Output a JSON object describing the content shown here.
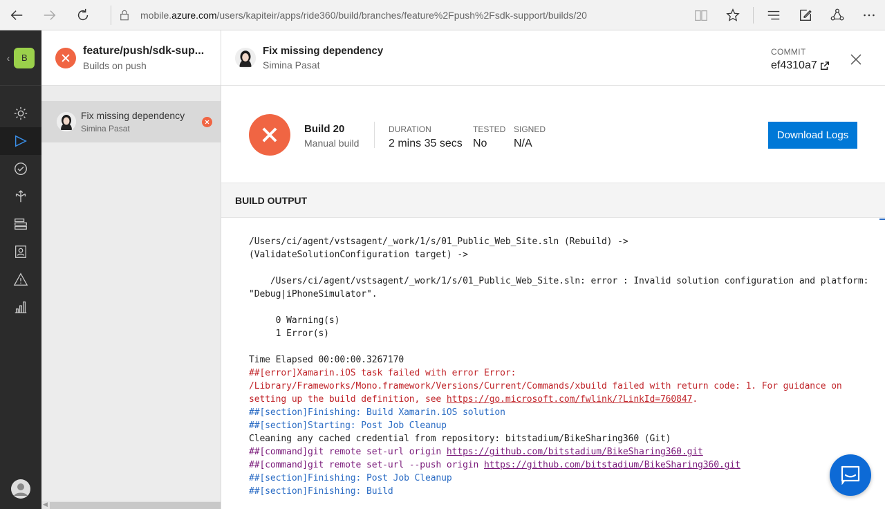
{
  "browser": {
    "url_prefix": "mobile.",
    "url_domain": "azure.com",
    "url_path": "/users/kapiteir/apps/ride360/build/branches/feature%2Fpush%2Fsdk-support/builds/20"
  },
  "rail": {
    "app_badge": "B",
    "items": [
      "overview",
      "build",
      "test",
      "distribute",
      "crashes",
      "analytics-users",
      "errors",
      "analytics"
    ]
  },
  "branch": {
    "title": "feature/push/sdk-sup...",
    "subtitle": "Builds on push"
  },
  "build_list": [
    {
      "title": "Fix missing dependency",
      "author": "Simina Pasat",
      "status": "failed"
    }
  ],
  "commit": {
    "title": "Fix missing dependency",
    "author": "Simina Pasat",
    "label": "COMMIT",
    "hash": "ef4310a7"
  },
  "summary": {
    "build_number": "Build 20",
    "build_type": "Manual build",
    "duration_label": "DURATION",
    "duration_value": "2 mins 35 secs",
    "tested_label": "TESTED",
    "tested_value": "No",
    "signed_label": "SIGNED",
    "signed_value": "N/A",
    "download_label": "Download Logs"
  },
  "output_title": "BUILD OUTPUT",
  "output_lines": [
    {
      "style": "n",
      "text": "/Users/ci/agent/vstsagent/_work/1/s/01_Public_Web_Site.sln (Rebuild) ->"
    },
    {
      "style": "n",
      "text": "(ValidateSolutionConfiguration target) ->"
    },
    {
      "style": "n",
      "text": ""
    },
    {
      "style": "n",
      "text": "    /Users/ci/agent/vstsagent/_work/1/s/01_Public_Web_Site.sln: error : Invalid solution configuration and platform:"
    },
    {
      "style": "n",
      "text": "\"Debug|iPhoneSimulator\"."
    },
    {
      "style": "n",
      "text": ""
    },
    {
      "style": "n",
      "text": "     0 Warning(s)"
    },
    {
      "style": "n",
      "text": "     1 Error(s)"
    },
    {
      "style": "n",
      "text": ""
    },
    {
      "style": "n",
      "text": "Time Elapsed 00:00:00.3267170"
    },
    {
      "style": "err",
      "text": "##[error]Xamarin.iOS task failed with error Error:"
    },
    {
      "style": "err",
      "text": "/Library/Frameworks/Mono.framework/Versions/Current/Commands/xbuild failed with return code: 1. For guidance on"
    },
    {
      "style": "err",
      "text": "setting up the build definition, see ",
      "link": "https://go.microsoft.com/fwlink/?LinkId=760847",
      "suffix": "."
    },
    {
      "style": "sec",
      "text": "##[section]Finishing: Build Xamarin.iOS solution"
    },
    {
      "style": "sec",
      "text": "##[section]Starting: Post Job Cleanup"
    },
    {
      "style": "n",
      "text": "Cleaning any cached credential from repository: bitstadium/BikeSharing360 (Git)"
    },
    {
      "style": "cmd",
      "text": "##[command]git remote set-url origin ",
      "link": "https://github.com/bitstadium/BikeSharing360.git"
    },
    {
      "style": "cmd",
      "text": "##[command]git remote set-url --push origin ",
      "link": "https://github.com/bitstadium/BikeSharing360.git"
    },
    {
      "style": "sec",
      "text": "##[section]Finishing: Post Job Cleanup"
    },
    {
      "style": "sec",
      "text": "##[section]Finishing: Build"
    }
  ]
}
